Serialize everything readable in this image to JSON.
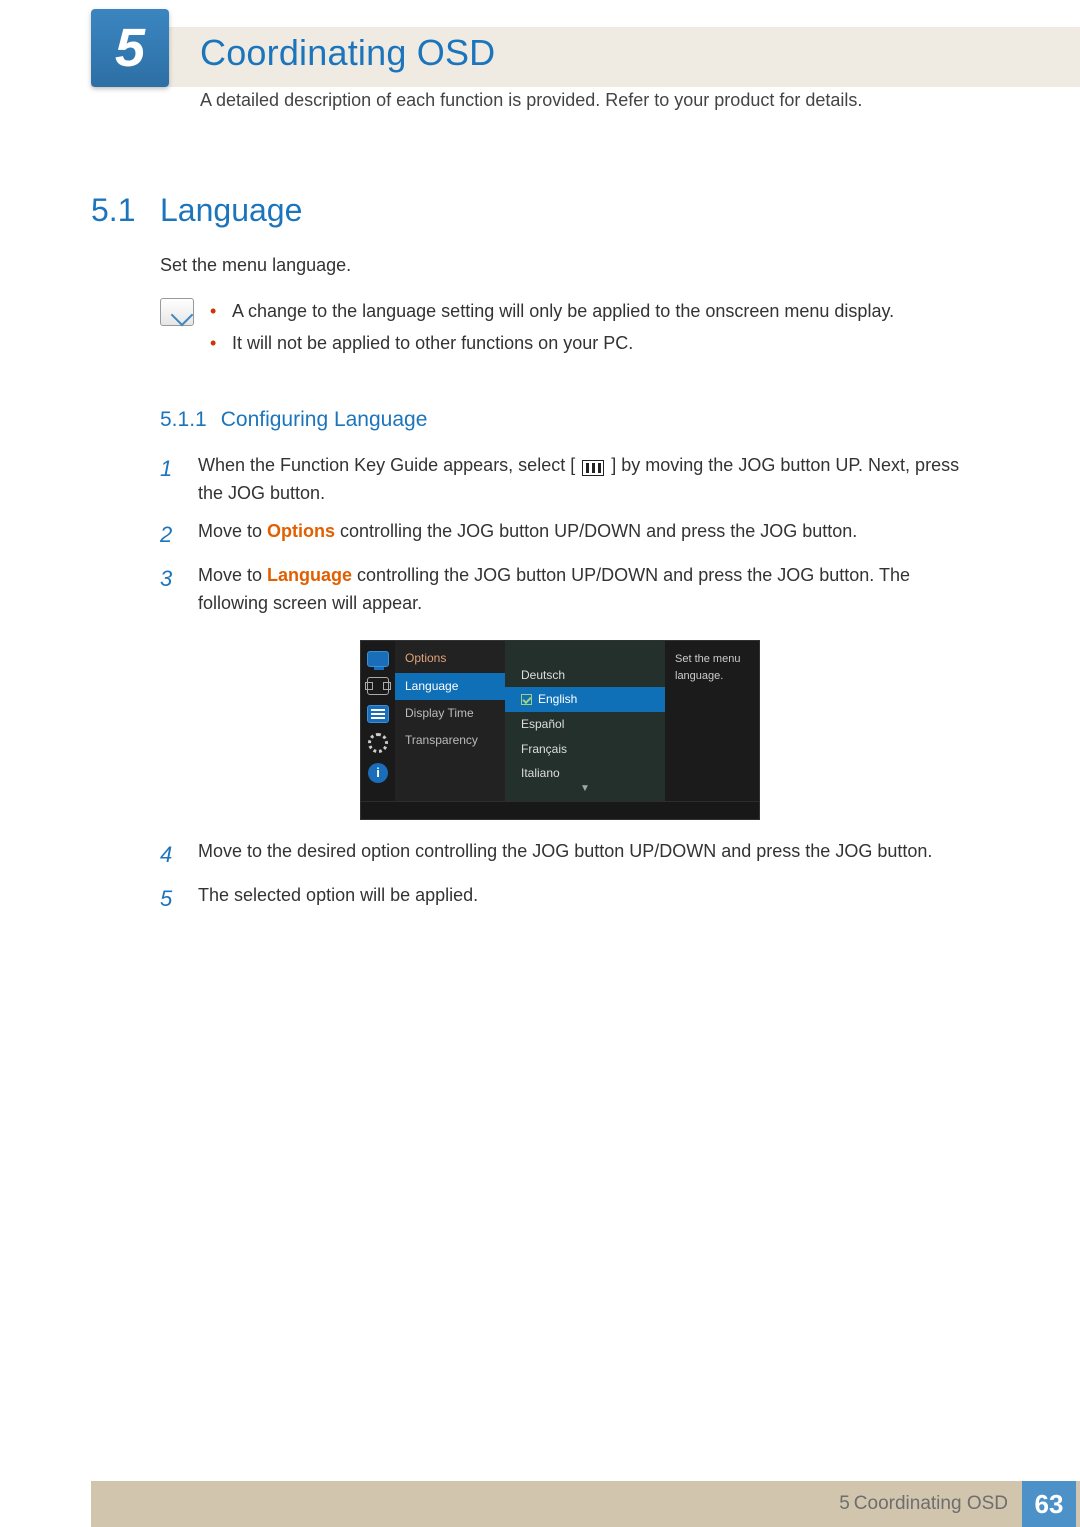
{
  "chapter": {
    "num": "5",
    "title": "Coordinating OSD",
    "desc": "A detailed description of each function is provided. Refer to your product for details."
  },
  "section": {
    "num": "5.1",
    "title": "Language"
  },
  "intro": "Set the menu language.",
  "notes": [
    "A change to the language setting will only be applied to the onscreen menu display.",
    "It will not be applied to other functions on your PC."
  ],
  "subsection": {
    "num": "5.1.1",
    "title": "Configuring Language"
  },
  "steps": {
    "s1a": "When the Function Key Guide appears, select [",
    "s1b": "] by moving the JOG button UP. Next, press the JOG button.",
    "s2a": "Move to ",
    "s2_opt": "Options",
    "s2b": " controlling the JOG button UP/DOWN and press the JOG button.",
    "s3a": "Move to ",
    "s3_lang": "Language",
    "s3b": " controlling the JOG button UP/DOWN and press the JOG button. The following screen will appear.",
    "s4": "Move to the desired option controlling the JOG button UP/DOWN and press the JOG button.",
    "s5": "The selected option will be applied."
  },
  "osd": {
    "left": {
      "header": "Options",
      "items": [
        "Language",
        "Display Time",
        "Transparency"
      ],
      "selected": "Language"
    },
    "mid": {
      "items": [
        "Deutsch",
        "English",
        "Español",
        "Français",
        "Italiano"
      ],
      "selected": "English",
      "arrow": "▼"
    },
    "right": "Set the menu language."
  },
  "footer": {
    "chapter": "5",
    "title": "Coordinating OSD",
    "page": "63"
  }
}
